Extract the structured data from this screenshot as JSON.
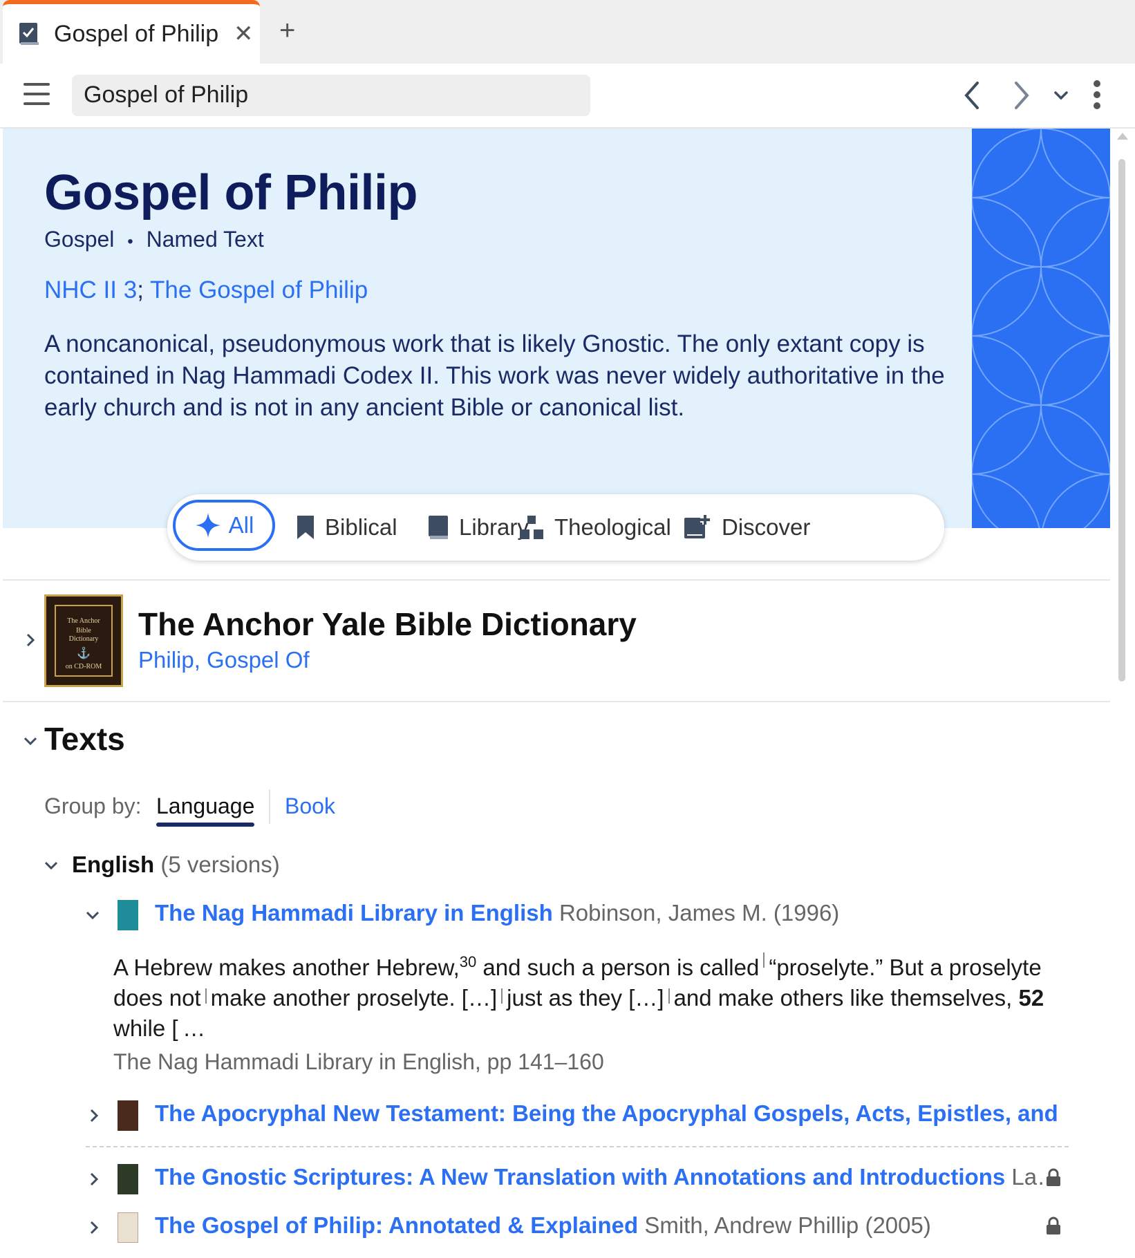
{
  "tab": {
    "title": "Gospel of Philip",
    "close": "✕",
    "new_tab": "+"
  },
  "toolbar": {
    "address": "Gospel of Philip"
  },
  "hero": {
    "title": "Gospel of Philip",
    "type": "Gospel",
    "bullet": "•",
    "subtype": "Named Text",
    "ref_1": "NHC II 3",
    "ref_sep": ";",
    "ref_2": "The Gospel of Philip",
    "description": "A noncanonical, pseudonymous work that is likely Gnostic. The only extant copy is contained in Nag Hammadi Codex II. This work was never widely authoritative in the early church and is not in any ancient Bible or canonical list.",
    "accent_color": "#2b6ff3"
  },
  "filters": {
    "all": "All",
    "biblical": "Biblical",
    "library": "Library",
    "theological": "Theological",
    "discover": "Discover"
  },
  "dictionary": {
    "title": "The Anchor Yale Bible Dictionary",
    "article": "Philip, Gospel Of",
    "cover_line1": "The Anchor",
    "cover_line2": "Bible",
    "cover_line3": "Dictionary",
    "cover_line4": "on CD-ROM"
  },
  "texts": {
    "heading": "Texts",
    "group_by_label": "Group by:",
    "group_language": "Language",
    "group_book": "Book",
    "language": "English",
    "language_count": "(5 versions)",
    "books": [
      {
        "title": "The Nag Hammadi Library in English",
        "author": "Robinson, James M. (1996)"
      },
      {
        "title": "The Apocryphal New Testament: Being the Apocryphal Gospels, Acts, Epistles, and Ap…",
        "author": ""
      },
      {
        "title": "The Gnostic Scriptures: A New Translation with Annotations and Introductions",
        "author": "La…"
      },
      {
        "title": "The Gospel of Philip: Annotated & Explained",
        "author": "Smith, Andrew Phillip (2005)"
      }
    ],
    "excerpt": {
      "part1": "A Hebrew makes another Hebrew,",
      "footnote": "30",
      "part2": " and such a person is called",
      "part3": "“proselyte.” But a proselyte does not",
      "part4": "make another proselyte. […]",
      "part5": "just as they […]",
      "part6": "and make others like themselves,",
      "page": "52",
      "part7": "while [ …",
      "source": "The Nag Hammadi Library in English, pp 141–160"
    }
  }
}
